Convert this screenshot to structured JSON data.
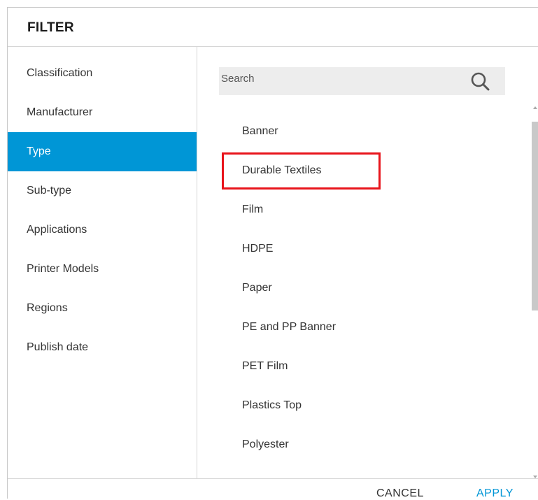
{
  "dialog": {
    "title": "FILTER"
  },
  "sidebar": {
    "items": [
      {
        "label": "Classification",
        "active": false
      },
      {
        "label": "Manufacturer",
        "active": false
      },
      {
        "label": "Type",
        "active": true
      },
      {
        "label": "Sub-type",
        "active": false
      },
      {
        "label": "Applications",
        "active": false
      },
      {
        "label": "Printer Models",
        "active": false
      },
      {
        "label": "Regions",
        "active": false
      },
      {
        "label": "Publish date",
        "active": false
      }
    ]
  },
  "search": {
    "placeholder": "Search",
    "value": "",
    "icon": "search-icon"
  },
  "options": {
    "items": [
      {
        "label": "Banner",
        "highlighted": false
      },
      {
        "label": "Durable Textiles",
        "highlighted": true
      },
      {
        "label": "Film",
        "highlighted": false
      },
      {
        "label": "HDPE",
        "highlighted": false
      },
      {
        "label": "Paper",
        "highlighted": false
      },
      {
        "label": "PE and PP Banner",
        "highlighted": false
      },
      {
        "label": "PET Film",
        "highlighted": false
      },
      {
        "label": "Plastics Top",
        "highlighted": false
      },
      {
        "label": "Polyester",
        "highlighted": false
      }
    ]
  },
  "footer": {
    "cancel_label": "CANCEL",
    "apply_label": "APPLY"
  },
  "colors": {
    "accent": "#0096d6",
    "highlight_border": "#e8141b",
    "search_background": "#ededed"
  }
}
